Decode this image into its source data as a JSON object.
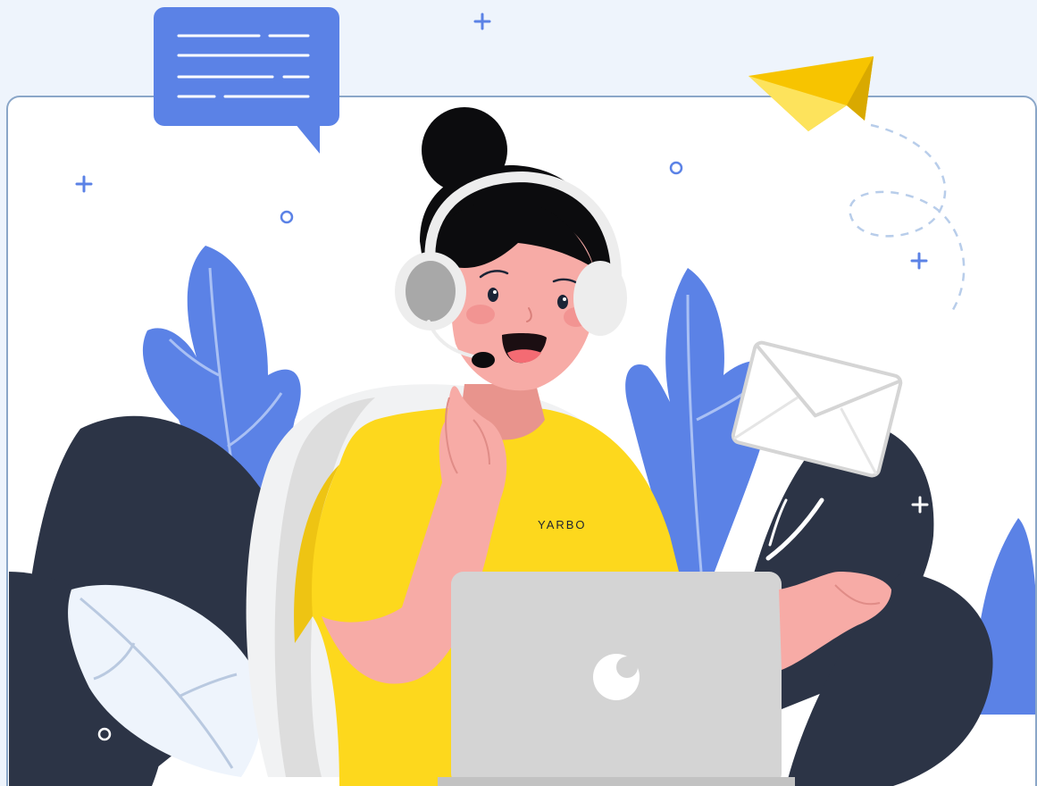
{
  "illustration": {
    "shirt_logo": "YARBO",
    "colors": {
      "page_bg": "#eef4fc",
      "panel_bg": "#ffffff",
      "panel_border": "#8aa6c8",
      "blue_accent": "#5b82e6",
      "dark_leaf": "#2c3446",
      "shirt_yellow": "#fdd81d",
      "skin": "#f7aba6",
      "hair": "#0c0c0e",
      "laptop_gray": "#d4d4d4",
      "plane_yellow": "#f7c400"
    },
    "icons": [
      "chat-bubble-icon",
      "paper-plane-icon",
      "envelope-icon",
      "headset-icon",
      "laptop-icon",
      "plus-sparkle-icon",
      "circle-sparkle-icon"
    ]
  }
}
